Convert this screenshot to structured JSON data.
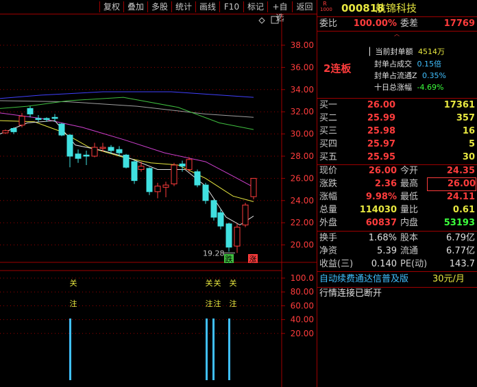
{
  "toolbar": {
    "items": [
      "复权",
      "叠加",
      "多股",
      "统计",
      "画线",
      "F10",
      "标记",
      "+自选",
      "返回"
    ]
  },
  "chart": {
    "price_ticks": [
      "38.00",
      "36.00",
      "34.00",
      "32.00",
      "30.00",
      "28.00",
      "26.00",
      "24.00",
      "22.00",
      "20.00"
    ],
    "ind_ticks": [
      "100.0",
      "80.00",
      "60.00",
      "40.00",
      "20.00"
    ],
    "low_label": "19.28",
    "fall_tag": "跌",
    "rise_tag": "涨",
    "attention": [
      "关",
      "注",
      "关",
      "关",
      "注",
      "注",
      "关",
      "注"
    ]
  },
  "stock": {
    "code_prefix": "R",
    "code_sub": "1000",
    "code": "000818",
    "name": "航锦科技",
    "wei_bi_label": "委比",
    "wei_bi": "100.00%",
    "wei_cha_label": "委差",
    "wei_cha": "17769",
    "limit_tag": "2连板",
    "seal_amount_label": "当前封单额",
    "seal_amount": "4514万",
    "seal_trade_label": "封单占成交",
    "seal_trade": "0.15倍",
    "seal_float_label": "封单占流通Z",
    "seal_float": "0.35%",
    "ten_day_label": "十日总涨幅",
    "ten_day": "-4.69%"
  },
  "bids": [
    {
      "label": "买一",
      "price": "26.00",
      "vol": "17361"
    },
    {
      "label": "买二",
      "price": "25.99",
      "vol": "357"
    },
    {
      "label": "买三",
      "price": "25.98",
      "vol": "16"
    },
    {
      "label": "买四",
      "price": "25.97",
      "vol": "5"
    },
    {
      "label": "买五",
      "price": "25.95",
      "vol": "30"
    }
  ],
  "quote": [
    {
      "l1": "现价",
      "v1": "26.00",
      "l2": "今开",
      "v2": "24.35",
      "c1": "red",
      "c2": "red"
    },
    {
      "l1": "涨跌",
      "v1": "2.36",
      "l2": "最高",
      "v2": "26.00",
      "c1": "red",
      "c2": "red"
    },
    {
      "l1": "涨幅",
      "v1": "9.98%",
      "l2": "最低",
      "v2": "24.11",
      "c1": "red",
      "c2": "red"
    },
    {
      "l1": "总量",
      "v1": "114030",
      "l2": "量比",
      "v2": "0.61",
      "c1": "yellow",
      "c2": "yellow"
    },
    {
      "l1": "外盘",
      "v1": "60837",
      "l2": "内盘",
      "v2": "53193",
      "c1": "red",
      "c2": "green"
    }
  ],
  "fund": [
    {
      "l1": "换手",
      "v1": "1.68%",
      "l2": "股本",
      "v2": "6.79亿"
    },
    {
      "l1": "净资",
      "v1": "5.39",
      "l2": "流通",
      "v2": "6.77亿"
    },
    {
      "l1": "收益(三)",
      "v1": "0.140",
      "l2": "PE(动)",
      "v2": "143.7"
    }
  ],
  "footer": {
    "ad_text": "自动续费通达信普及版",
    "ad_price": "30元/月",
    "status": "行情连接已断开"
  },
  "colors": {
    "up": "#ff3c3c",
    "down": "#40e0e0",
    "ma5": "#e0e0e0",
    "ma10": "#e8e840",
    "ma20": "#d040d0",
    "ma60": "#40c040",
    "ma120": "#a0a0a0",
    "ma250": "#4040ff"
  }
}
